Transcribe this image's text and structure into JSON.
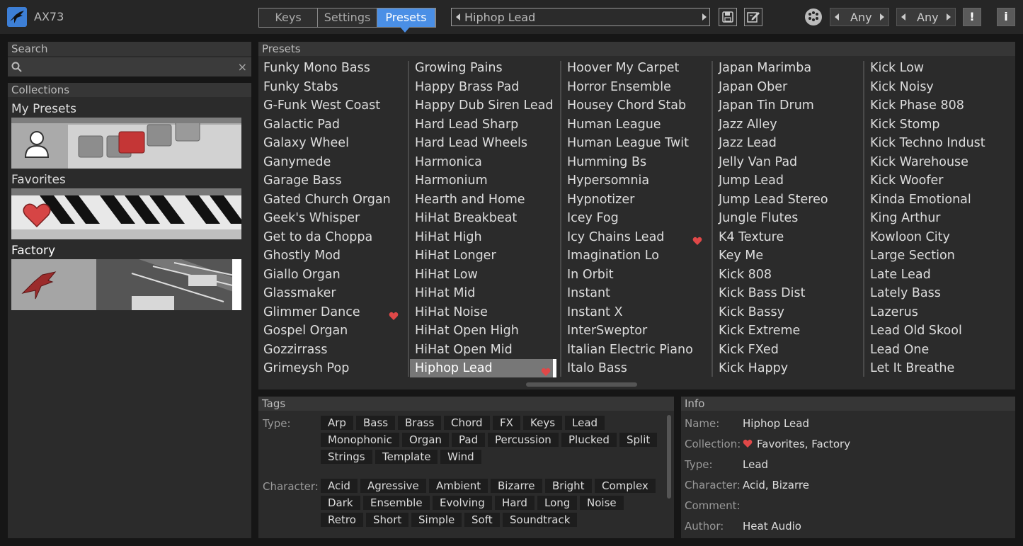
{
  "app": {
    "name": "AX73"
  },
  "header": {
    "tabs": [
      {
        "label": "Keys",
        "active": false
      },
      {
        "label": "Settings",
        "active": false
      },
      {
        "label": "Presets",
        "active": true
      }
    ],
    "current_preset": "Hiphop Lead",
    "filter1": "Any",
    "filter2": "Any",
    "alert_label": "!",
    "info_label": "i",
    "accent_color": "#4a8fe6"
  },
  "search": {
    "header": "Search",
    "value": "",
    "clear_icon": "×"
  },
  "collections": {
    "header": "Collections",
    "items": [
      {
        "label": "My Presets",
        "icon": "user-icon"
      },
      {
        "label": "Favorites",
        "icon": "heart-icon"
      },
      {
        "label": "Factory",
        "icon": "bird-icon"
      }
    ]
  },
  "presets": {
    "header": "Presets",
    "selected": "Hiphop Lead",
    "columns": [
      [
        {
          "name": "Funky Mono Bass"
        },
        {
          "name": "Funky Stabs"
        },
        {
          "name": "G-Funk West Coast"
        },
        {
          "name": "Galactic Pad"
        },
        {
          "name": "Galaxy Wheel"
        },
        {
          "name": "Ganymede"
        },
        {
          "name": "Garage Bass"
        },
        {
          "name": "Gated Church Organ"
        },
        {
          "name": "Geek's Whisper"
        },
        {
          "name": "Get to da Choppa"
        },
        {
          "name": "Ghostly Mod"
        },
        {
          "name": "Giallo Organ"
        },
        {
          "name": "Glassmaker"
        },
        {
          "name": "Glimmer Dance",
          "fav": true
        },
        {
          "name": "Gospel Organ"
        },
        {
          "name": "Gozzirrass"
        },
        {
          "name": "Grimeysh Pop"
        }
      ],
      [
        {
          "name": "Growing Pains"
        },
        {
          "name": "Happy Brass Pad"
        },
        {
          "name": "Happy Dub Siren Lead"
        },
        {
          "name": "Hard Lead Sharp"
        },
        {
          "name": "Hard Lead Wheels"
        },
        {
          "name": "Harmonica"
        },
        {
          "name": "Harmonium"
        },
        {
          "name": "Hearth and Home"
        },
        {
          "name": "HiHat Breakbeat"
        },
        {
          "name": "HiHat High"
        },
        {
          "name": "HiHat Longer"
        },
        {
          "name": "HiHat Low"
        },
        {
          "name": "HiHat Mid"
        },
        {
          "name": "HiHat Noise"
        },
        {
          "name": "HiHat Open High"
        },
        {
          "name": "HiHat Open Mid"
        },
        {
          "name": "Hiphop Lead",
          "fav": true,
          "selected": true
        }
      ],
      [
        {
          "name": "Hoover My Carpet"
        },
        {
          "name": "Horror Ensemble"
        },
        {
          "name": "Housey Chord Stab"
        },
        {
          "name": "Human League"
        },
        {
          "name": "Human League Twit"
        },
        {
          "name": "Humming Bs"
        },
        {
          "name": "Hypersomnia"
        },
        {
          "name": "Hypnotizer"
        },
        {
          "name": "Icey Fog"
        },
        {
          "name": "Icy Chains Lead",
          "fav": true
        },
        {
          "name": "Imagination Lo"
        },
        {
          "name": "In Orbit"
        },
        {
          "name": "Instant"
        },
        {
          "name": "Instant X"
        },
        {
          "name": "InterSweptor"
        },
        {
          "name": "Italian Electric Piano"
        },
        {
          "name": "Italo Bass"
        }
      ],
      [
        {
          "name": "Japan Marimba"
        },
        {
          "name": "Japan Ober"
        },
        {
          "name": "Japan Tin Drum"
        },
        {
          "name": "Jazz Alley"
        },
        {
          "name": "Jazz Lead"
        },
        {
          "name": "Jelly Van Pad"
        },
        {
          "name": "Jump Lead"
        },
        {
          "name": "Jump Lead Stereo"
        },
        {
          "name": "Jungle Flutes"
        },
        {
          "name": "K4 Texture"
        },
        {
          "name": "Key Me"
        },
        {
          "name": "Kick 808"
        },
        {
          "name": "Kick Bass Dist"
        },
        {
          "name": "Kick Bassy"
        },
        {
          "name": "Kick Extreme"
        },
        {
          "name": "Kick FXed"
        },
        {
          "name": "Kick Happy"
        }
      ],
      [
        {
          "name": "Kick Low"
        },
        {
          "name": "Kick Noisy"
        },
        {
          "name": "Kick Phase 808"
        },
        {
          "name": "Kick Stomp"
        },
        {
          "name": "Kick Techno Indust"
        },
        {
          "name": "Kick Warehouse"
        },
        {
          "name": "Kick Woofer"
        },
        {
          "name": "Kinda Emotional"
        },
        {
          "name": "King Arthur"
        },
        {
          "name": "Kowloon City"
        },
        {
          "name": "Large Section"
        },
        {
          "name": "Late Lead"
        },
        {
          "name": "Lately Bass"
        },
        {
          "name": "Lazerus"
        },
        {
          "name": "Lead Old Skool"
        },
        {
          "name": "Lead One"
        },
        {
          "name": "Let It Breathe"
        }
      ]
    ]
  },
  "tags": {
    "header": "Tags",
    "type_label": "Type:",
    "character_label": "Character:",
    "type_rows": [
      [
        "Arp",
        "Bass",
        "Brass",
        "Chord",
        "FX",
        "Keys",
        "Lead"
      ],
      [
        "Monophonic",
        "Organ",
        "Pad",
        "Percussion",
        "Plucked",
        "Split"
      ],
      [
        "Strings",
        "Template",
        "Wind"
      ]
    ],
    "character_rows": [
      [
        "Acid",
        "Agressive",
        "Ambient",
        "Bizarre",
        "Bright",
        "Complex"
      ],
      [
        "Dark",
        "Ensemble",
        "Evolving",
        "Hard",
        "Long",
        "Noise"
      ],
      [
        "Retro",
        "Short",
        "Simple",
        "Soft",
        "Soundtrack"
      ]
    ]
  },
  "info": {
    "header": "Info",
    "rows": [
      {
        "key": "Name:",
        "value": "Hiphop Lead"
      },
      {
        "key": "Collection:",
        "value": "Favorites, Factory",
        "heart": true
      },
      {
        "key": "Type:",
        "value": "Lead"
      },
      {
        "key": "Character:",
        "value": "Acid, Bizarre"
      },
      {
        "key": "Comment:",
        "value": ""
      },
      {
        "key": "Author:",
        "value": "Heat Audio"
      }
    ]
  },
  "colors": {
    "heart": "#e04848",
    "selected_row": "#777777"
  }
}
